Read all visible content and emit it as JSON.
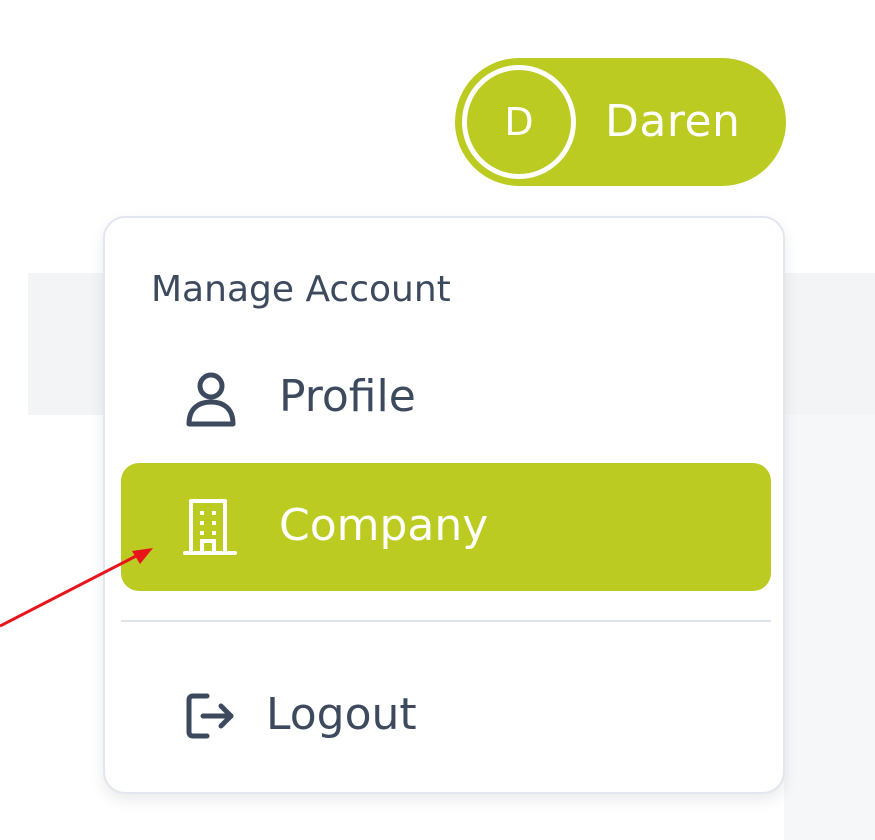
{
  "user": {
    "initial": "D",
    "name": "Daren"
  },
  "menu": {
    "heading": "Manage Account",
    "items": [
      {
        "label": "Profile",
        "icon": "user-icon"
      },
      {
        "label": "Company",
        "icon": "building-icon",
        "active": true
      },
      {
        "label": "Logout",
        "icon": "logout-icon"
      }
    ]
  },
  "colors": {
    "accent": "#bccb22",
    "text": "#3d4a5e",
    "annotation": "#e8141c"
  }
}
